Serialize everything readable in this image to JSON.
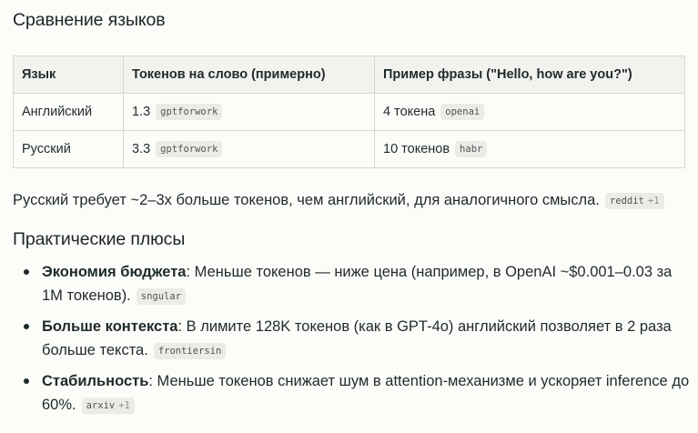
{
  "section1": {
    "title": "Сравнение языков"
  },
  "table": {
    "headers": [
      "Язык",
      "Токенов на слово (примерно)",
      "Пример фразы (\"Hello, how are you?\")"
    ],
    "rows": [
      {
        "lang": "Английский",
        "tokens": "1.3",
        "tokens_source": "gptforwork",
        "example": "4 токена",
        "example_source": "openai"
      },
      {
        "lang": "Русский",
        "tokens": "3.3",
        "tokens_source": "gptforwork",
        "example": "10 токенов",
        "example_source": "habr"
      }
    ]
  },
  "paragraph": {
    "text": "Русский требует ~2–3x больше токенов, чем английский, для аналогичного смысла.",
    "source": "reddit",
    "source_extra": "+1"
  },
  "section2": {
    "title": "Практические плюсы"
  },
  "benefits": [
    {
      "term": "Экономия бюджета",
      "text": ": Меньше токенов — ниже цена (например, в OpenAI ~$0.001–0.03 за 1M токенов).",
      "source": "sngular",
      "source_extra": ""
    },
    {
      "term": "Больше контекста",
      "text": ": В лимите 128K токенов (как в GPT-4o) английский позволяет в 2 раза больше текста.",
      "source": "frontiersin",
      "source_extra": ""
    },
    {
      "term": "Стабильность",
      "text": ": Меньше токенов снижает шум в attention-механизме и ускоряет inference до 60%.",
      "source": "arxiv",
      "source_extra": "+1"
    }
  ]
}
